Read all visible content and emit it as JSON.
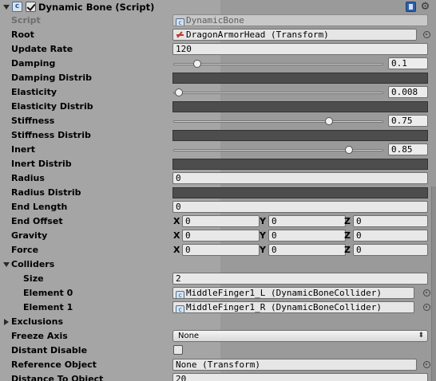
{
  "component": {
    "title": "Dynamic Bone (Script)",
    "enabled": true
  },
  "fields": {
    "script": {
      "label": "Script",
      "value": "DynamicBone"
    },
    "root": {
      "label": "Root",
      "value": "DragonArmorHead (Transform)"
    },
    "update_rate": {
      "label": "Update Rate",
      "value": "120"
    },
    "damping": {
      "label": "Damping",
      "value": "0.1",
      "fraction": 0.1
    },
    "damping_distrib": {
      "label": "Damping Distrib"
    },
    "elasticity": {
      "label": "Elasticity",
      "value": "0.008",
      "fraction": 0.008
    },
    "elasticity_distrib": {
      "label": "Elasticity Distrib"
    },
    "stiffness": {
      "label": "Stiffness",
      "value": "0.75",
      "fraction": 0.75
    },
    "stiffness_distrib": {
      "label": "Stiffness Distrib"
    },
    "inert": {
      "label": "Inert",
      "value": "0.85",
      "fraction": 0.85
    },
    "inert_distrib": {
      "label": "Inert Distrib"
    },
    "radius": {
      "label": "Radius",
      "value": "0"
    },
    "radius_distrib": {
      "label": "Radius Distrib"
    },
    "end_length": {
      "label": "End Length",
      "value": "0"
    },
    "end_offset": {
      "label": "End Offset",
      "x": "0",
      "y": "0",
      "z": "0"
    },
    "gravity": {
      "label": "Gravity",
      "x": "0",
      "y": "0",
      "z": "0"
    },
    "force": {
      "label": "Force",
      "x": "0",
      "y": "0",
      "z": "0"
    },
    "colliders": {
      "label": "Colliders",
      "size_label": "Size",
      "size": "2",
      "elements": [
        {
          "label": "Element 0",
          "value": "MiddleFinger1_L (DynamicBoneCollider)"
        },
        {
          "label": "Element 1",
          "value": "MiddleFinger1_R (DynamicBoneCollider)"
        }
      ]
    },
    "exclusions": {
      "label": "Exclusions"
    },
    "freeze_axis": {
      "label": "Freeze Axis",
      "value": "None"
    },
    "distant_disable": {
      "label": "Distant Disable",
      "checked": false
    },
    "reference_object": {
      "label": "Reference Object",
      "value": "None (Transform)"
    },
    "distance_to_object": {
      "label": "Distance To Object",
      "value": "20"
    }
  },
  "axis_labels": {
    "x": "X",
    "y": "Y",
    "z": "Z"
  },
  "icons": {
    "script": "c#-script-icon",
    "help": "book-icon",
    "settings": "gear-icon"
  }
}
